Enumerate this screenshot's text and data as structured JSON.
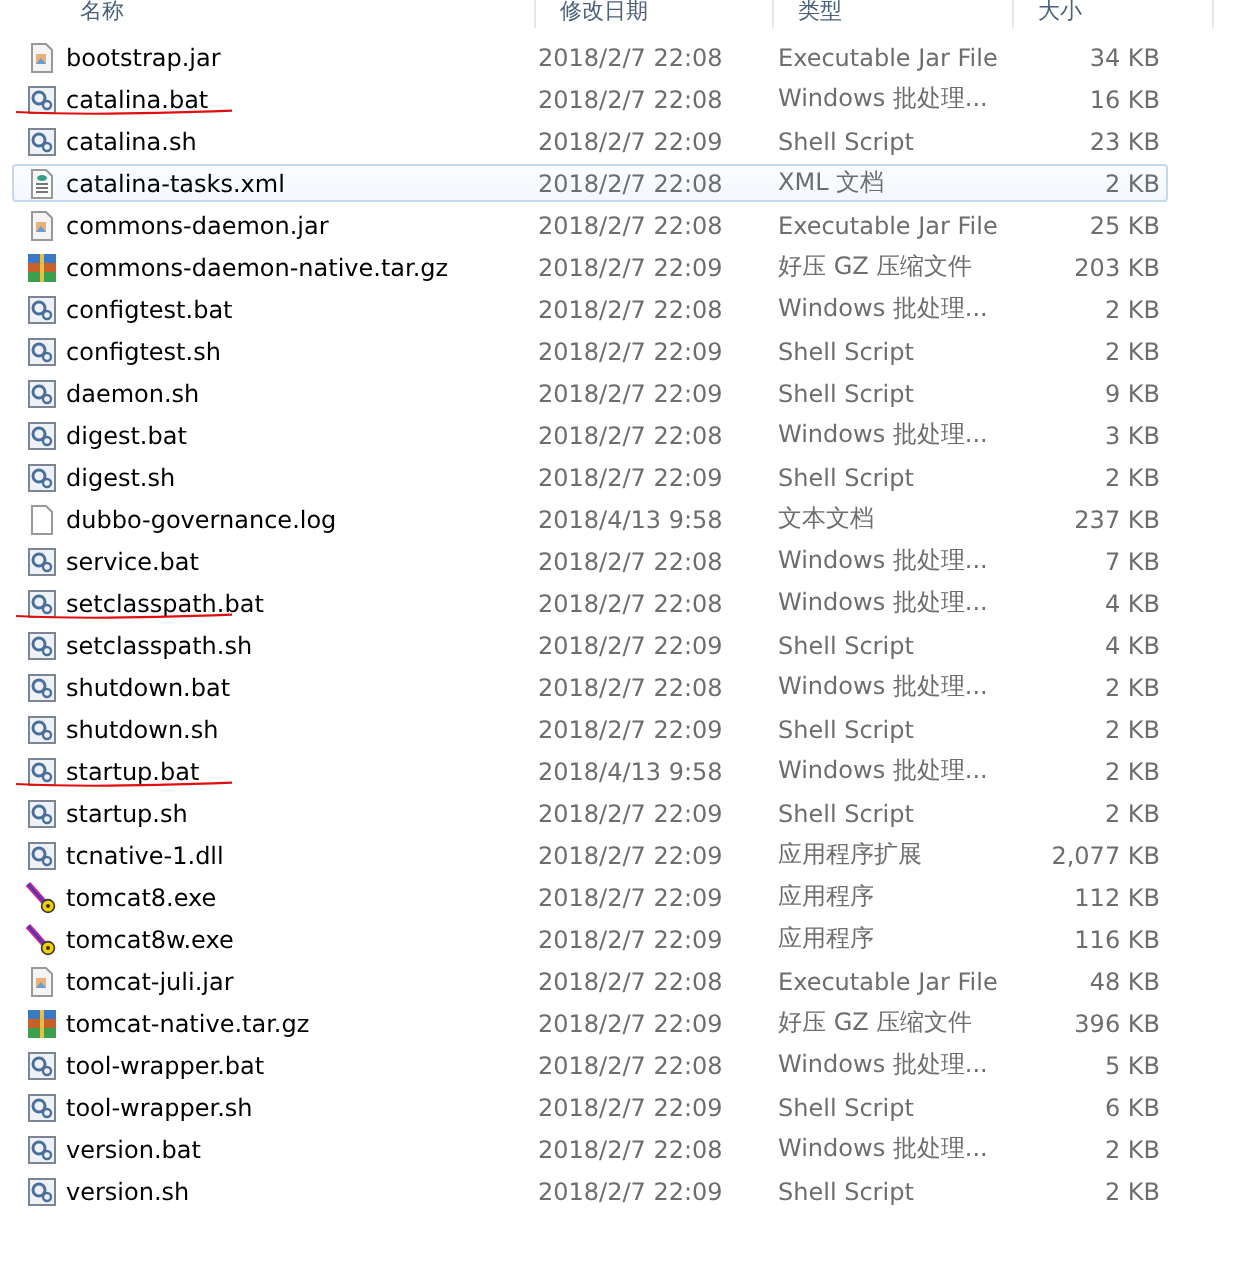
{
  "columns": [
    "名称",
    "修改日期",
    "类型",
    "大小"
  ],
  "files": [
    {
      "name": "bootstrap.jar",
      "kind": "jar",
      "date": "2018/2/7 22:08",
      "type": "Executable Jar File",
      "size": "34 KB",
      "selected": false,
      "underlined": false
    },
    {
      "name": "catalina.bat",
      "kind": "script",
      "date": "2018/2/7 22:08",
      "type": "Windows 批处理...",
      "size": "16 KB",
      "selected": false,
      "underlined": true
    },
    {
      "name": "catalina.sh",
      "kind": "script",
      "date": "2018/2/7 22:09",
      "type": "Shell Script",
      "size": "23 KB",
      "selected": false,
      "underlined": false
    },
    {
      "name": "catalina-tasks.xml",
      "kind": "xml",
      "date": "2018/2/7 22:08",
      "type": "XML 文档",
      "size": "2 KB",
      "selected": true,
      "underlined": false
    },
    {
      "name": "commons-daemon.jar",
      "kind": "jar",
      "date": "2018/2/7 22:08",
      "type": "Executable Jar File",
      "size": "25 KB",
      "selected": false,
      "underlined": false
    },
    {
      "name": "commons-daemon-native.tar.gz",
      "kind": "archive",
      "date": "2018/2/7 22:09",
      "type": "好压 GZ 压缩文件",
      "size": "203 KB",
      "selected": false,
      "underlined": false
    },
    {
      "name": "configtest.bat",
      "kind": "script",
      "date": "2018/2/7 22:08",
      "type": "Windows 批处理...",
      "size": "2 KB",
      "selected": false,
      "underlined": false
    },
    {
      "name": "configtest.sh",
      "kind": "script",
      "date": "2018/2/7 22:09",
      "type": "Shell Script",
      "size": "2 KB",
      "selected": false,
      "underlined": false
    },
    {
      "name": "daemon.sh",
      "kind": "script",
      "date": "2018/2/7 22:09",
      "type": "Shell Script",
      "size": "9 KB",
      "selected": false,
      "underlined": false
    },
    {
      "name": "digest.bat",
      "kind": "script",
      "date": "2018/2/7 22:08",
      "type": "Windows 批处理...",
      "size": "3 KB",
      "selected": false,
      "underlined": false
    },
    {
      "name": "digest.sh",
      "kind": "script",
      "date": "2018/2/7 22:09",
      "type": "Shell Script",
      "size": "2 KB",
      "selected": false,
      "underlined": false
    },
    {
      "name": "dubbo-governance.log",
      "kind": "text",
      "date": "2018/4/13 9:58",
      "type": "文本文档",
      "size": "237 KB",
      "selected": false,
      "underlined": false
    },
    {
      "name": "service.bat",
      "kind": "script",
      "date": "2018/2/7 22:08",
      "type": "Windows 批处理...",
      "size": "7 KB",
      "selected": false,
      "underlined": false
    },
    {
      "name": "setclasspath.bat",
      "kind": "script",
      "date": "2018/2/7 22:08",
      "type": "Windows 批处理...",
      "size": "4 KB",
      "selected": false,
      "underlined": true
    },
    {
      "name": "setclasspath.sh",
      "kind": "script",
      "date": "2018/2/7 22:09",
      "type": "Shell Script",
      "size": "4 KB",
      "selected": false,
      "underlined": false
    },
    {
      "name": "shutdown.bat",
      "kind": "script",
      "date": "2018/2/7 22:08",
      "type": "Windows 批处理...",
      "size": "2 KB",
      "selected": false,
      "underlined": false
    },
    {
      "name": "shutdown.sh",
      "kind": "script",
      "date": "2018/2/7 22:09",
      "type": "Shell Script",
      "size": "2 KB",
      "selected": false,
      "underlined": false
    },
    {
      "name": "startup.bat",
      "kind": "script",
      "date": "2018/4/13 9:58",
      "type": "Windows 批处理...",
      "size": "2 KB",
      "selected": false,
      "underlined": true
    },
    {
      "name": "startup.sh",
      "kind": "script",
      "date": "2018/2/7 22:09",
      "type": "Shell Script",
      "size": "2 KB",
      "selected": false,
      "underlined": false
    },
    {
      "name": "tcnative-1.dll",
      "kind": "dll",
      "date": "2018/2/7 22:09",
      "type": "应用程序扩展",
      "size": "2,077 KB",
      "selected": false,
      "underlined": false
    },
    {
      "name": "tomcat8.exe",
      "kind": "exe",
      "date": "2018/2/7 22:09",
      "type": "应用程序",
      "size": "112 KB",
      "selected": false,
      "underlined": false
    },
    {
      "name": "tomcat8w.exe",
      "kind": "exe",
      "date": "2018/2/7 22:09",
      "type": "应用程序",
      "size": "116 KB",
      "selected": false,
      "underlined": false
    },
    {
      "name": "tomcat-juli.jar",
      "kind": "jar",
      "date": "2018/2/7 22:08",
      "type": "Executable Jar File",
      "size": "48 KB",
      "selected": false,
      "underlined": false
    },
    {
      "name": "tomcat-native.tar.gz",
      "kind": "archive",
      "date": "2018/2/7 22:09",
      "type": "好压 GZ 压缩文件",
      "size": "396 KB",
      "selected": false,
      "underlined": false
    },
    {
      "name": "tool-wrapper.bat",
      "kind": "script",
      "date": "2018/2/7 22:08",
      "type": "Windows 批处理...",
      "size": "5 KB",
      "selected": false,
      "underlined": false
    },
    {
      "name": "tool-wrapper.sh",
      "kind": "script",
      "date": "2018/2/7 22:09",
      "type": "Shell Script",
      "size": "6 KB",
      "selected": false,
      "underlined": false
    },
    {
      "name": "version.bat",
      "kind": "script",
      "date": "2018/2/7 22:08",
      "type": "Windows 批处理...",
      "size": "2 KB",
      "selected": false,
      "underlined": false
    },
    {
      "name": "version.sh",
      "kind": "script",
      "date": "2018/2/7 22:09",
      "type": "Shell Script",
      "size": "2 KB",
      "selected": false,
      "underlined": false
    }
  ]
}
